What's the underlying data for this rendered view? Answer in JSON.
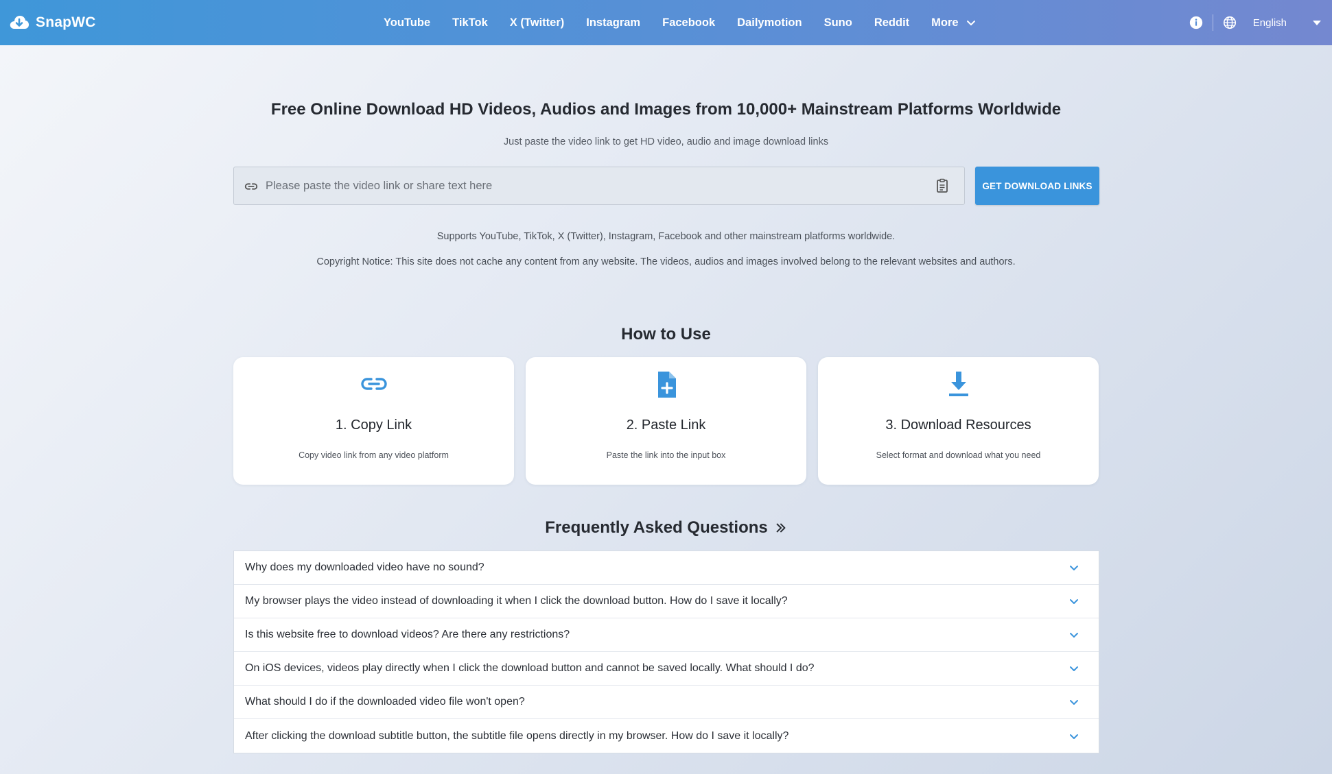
{
  "header": {
    "brand": "SnapWC",
    "nav": [
      {
        "label": "YouTube"
      },
      {
        "label": "TikTok"
      },
      {
        "label": "X (Twitter)"
      },
      {
        "label": "Instagram"
      },
      {
        "label": "Facebook"
      },
      {
        "label": "Dailymotion"
      },
      {
        "label": "Suno"
      },
      {
        "label": "Reddit"
      },
      {
        "label": "More"
      }
    ],
    "language": "English",
    "colors": {
      "gradient_start": "#3f97d9",
      "gradient_end": "#7488d0"
    }
  },
  "hero": {
    "title": "Free Online Download HD Videos, Audios and Images from 10,000+ Mainstream Platforms Worldwide",
    "subtitle": "Just paste the video link to get HD video, audio and image download links",
    "search_placeholder": "Please paste the video link or share text here",
    "search_value": "",
    "button_label": "GET DOWNLOAD LINKS",
    "supports": "Supports YouTube, TikTok, X (Twitter), Instagram, Facebook and other mainstream platforms worldwide.",
    "copyright": "Copyright Notice: This site does not cache any content from any website. The videos, audios and images involved belong to the relevant websites and authors."
  },
  "howto": {
    "title": "How to Use",
    "steps": [
      {
        "icon": "link-icon",
        "title": "1. Copy Link",
        "desc": "Copy video link from any video platform"
      },
      {
        "icon": "file-plus-icon",
        "title": "2. Paste Link",
        "desc": "Paste the link into the input box"
      },
      {
        "icon": "download-icon",
        "title": "3. Download Resources",
        "desc": "Select format and download what you need"
      }
    ]
  },
  "faq": {
    "title": "Frequently Asked Questions",
    "items": [
      {
        "q": "Why does my downloaded video have no sound?"
      },
      {
        "q": "My browser plays the video instead of downloading it when I click the download button. How do I save it locally?"
      },
      {
        "q": "Is this website free to download videos? Are there any restrictions?"
      },
      {
        "q": "On iOS devices, videos play directly when I click the download button and cannot be saved locally. What should I do?"
      },
      {
        "q": "What should I do if the downloaded video file won't open?"
      },
      {
        "q": "After clicking the download subtitle button, the subtitle file opens directly in my browser. How do I save it locally?"
      }
    ]
  },
  "accent_color": "#3a94dc"
}
